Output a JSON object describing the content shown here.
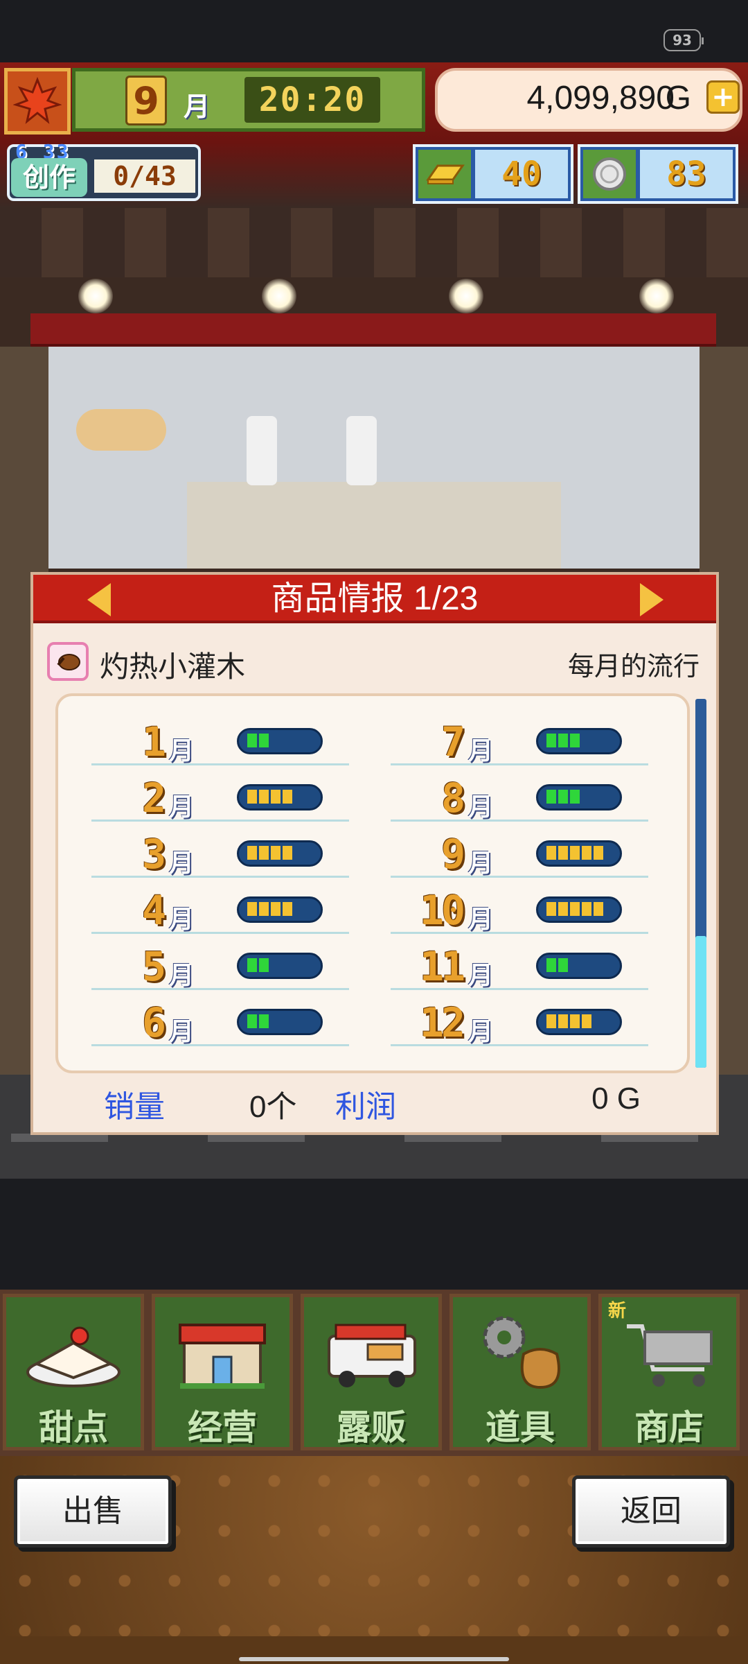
{
  "status": {
    "battery": "93"
  },
  "hud": {
    "month": "9",
    "month_unit": "月",
    "time": "20:20",
    "money": "4,099,890",
    "money_unit": "G",
    "create_small": "6 33",
    "create_label": "创作",
    "create_count": "0/43",
    "gold": "40",
    "silver": "83"
  },
  "panel": {
    "title": "商品情报 1/23",
    "item_name": "灼热小灌木",
    "trend_label": "每月的流行",
    "month_unit": "月",
    "months_left": [
      {
        "num": "1",
        "level": 2
      },
      {
        "num": "2",
        "level": 4
      },
      {
        "num": "3",
        "level": 4
      },
      {
        "num": "4",
        "level": 4
      },
      {
        "num": "5",
        "level": 2
      },
      {
        "num": "6",
        "level": 2
      }
    ],
    "months_right": [
      {
        "num": "7",
        "level": 3
      },
      {
        "num": "8",
        "level": 3
      },
      {
        "num": "9",
        "level": 5
      },
      {
        "num": "10",
        "level": 5
      },
      {
        "num": "11",
        "level": 2
      },
      {
        "num": "12",
        "level": 4
      }
    ],
    "sales_label": "销量",
    "sales_value": "0个",
    "profit_label": "利润",
    "profit_value": "0 G"
  },
  "menu": {
    "items": [
      {
        "label": "甜点",
        "icon": "cake-icon"
      },
      {
        "label": "经营",
        "icon": "shop-building-icon"
      },
      {
        "label": "露贩",
        "icon": "food-truck-icon"
      },
      {
        "label": "道具",
        "icon": "gear-sack-icon"
      },
      {
        "label": "商店",
        "icon": "shopping-cart-icon"
      }
    ],
    "new_badge": "新"
  },
  "actions": {
    "sell": "出售",
    "back": "返回"
  },
  "colors": {
    "green_level": "#2fd63a",
    "yellow_level": "#f4c231",
    "title_red": "#c42016",
    "label_blue": "#2f56e0"
  }
}
